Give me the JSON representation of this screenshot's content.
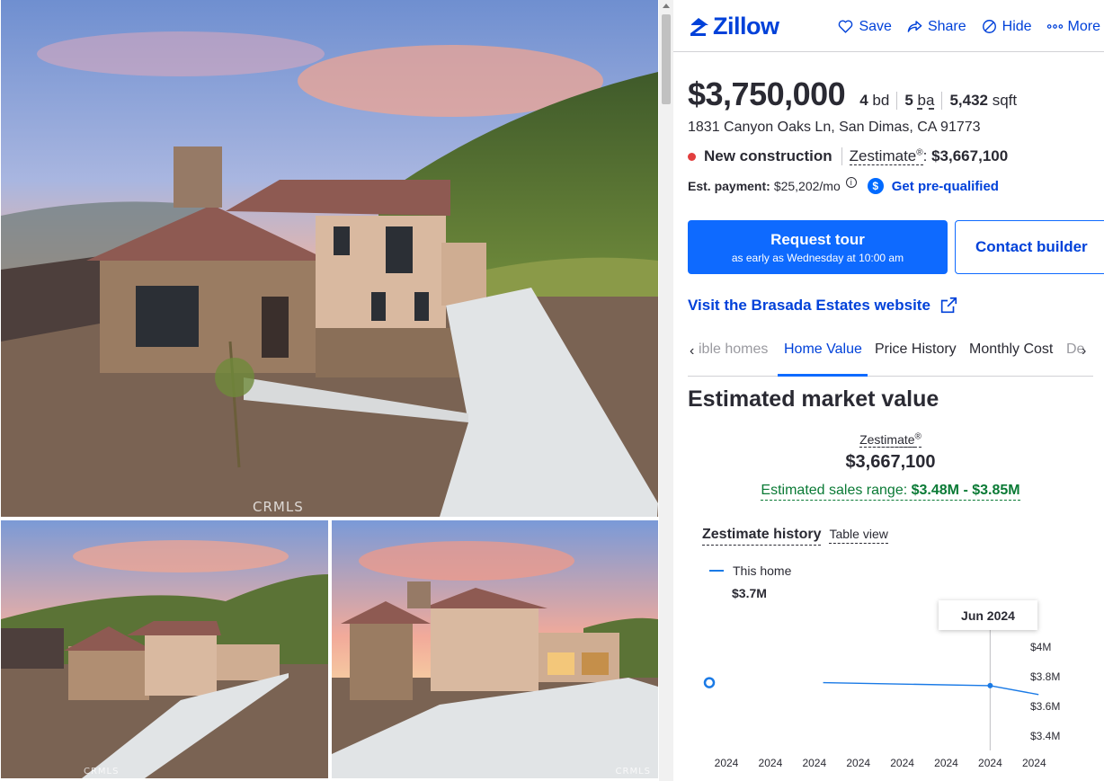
{
  "photos": {
    "watermark": "CRMLS",
    "items": [
      {
        "label": "Front exterior with hillside at sunset"
      },
      {
        "label": "Aerial side view of house"
      },
      {
        "label": "Front view with driveway and garage lights"
      }
    ]
  },
  "header": {
    "brand": "Zillow",
    "actions": [
      {
        "label": "Save",
        "icon": "heart-icon"
      },
      {
        "label": "Share",
        "icon": "share-icon"
      },
      {
        "label": "Hide",
        "icon": "hide-icon"
      },
      {
        "label": "More",
        "icon": "more-icon"
      }
    ]
  },
  "listing": {
    "price": "$3,750,000",
    "beds_num": "4",
    "beds_unit": "bd",
    "baths_num": "5",
    "baths_unit": "ba",
    "sqft_num": "5,432",
    "sqft_unit": "sqft",
    "address": "1831 Canyon Oaks Ln, San Dimas, CA 91773",
    "status": "New construction",
    "status_color": "#e23e3e",
    "zestimate_label": "Zestimate",
    "zestimate_mark": "®",
    "zestimate_value": "$3,667,100",
    "payment_label": "Est. payment:",
    "payment_value": "$25,202/mo",
    "prequal_label": "Get pre-qualified"
  },
  "cta": {
    "tour_title": "Request tour",
    "tour_sub": "as early as Wednesday at 10:00 am",
    "contact": "Contact builder",
    "visit": "Visit the Brasada Estates website"
  },
  "tabs": {
    "items": [
      {
        "label": "ible homes"
      },
      {
        "label": "Home Value"
      },
      {
        "label": "Price History"
      },
      {
        "label": "Monthly Cost"
      },
      {
        "label": "De"
      }
    ],
    "active_index": 1
  },
  "value": {
    "title": "Estimated market value",
    "zestimate_label": "Zestimate",
    "zestimate_mark": "®",
    "zestimate_value": "$3,667,100",
    "range_label": "Estimated sales range:",
    "range_value": "$3.48M - $3.85M"
  },
  "history": {
    "title": "Zestimate history",
    "table_view": "Table view",
    "legend": "This home",
    "legend_value": "$3.7M",
    "tooltip": "Jun 2024"
  },
  "chart_data": {
    "type": "line",
    "x_tick_labels": [
      "2024",
      "2024",
      "2024",
      "2024",
      "2024",
      "2024",
      "2024",
      "2024"
    ],
    "y_tick_labels": [
      "$4M",
      "$3.8M",
      "$3.6M",
      "$3.4M"
    ],
    "y_ticks": [
      4.0,
      3.8,
      3.6,
      3.4
    ],
    "ylim": [
      3.4,
      4.0
    ],
    "series": [
      {
        "name": "This home",
        "color": "#1a7ae6",
        "points": [
          {
            "x": 2.2,
            "y": 3.76
          },
          {
            "x": 6.0,
            "y": 3.74
          },
          {
            "x": 7.1,
            "y": 3.68
          }
        ]
      }
    ],
    "highlight_index": 6,
    "highlight_value": 3.74,
    "grid": false
  },
  "colors": {
    "brand": "#0041d9",
    "primary_button": "#0e6aff",
    "range_green": "#0a7a35"
  }
}
